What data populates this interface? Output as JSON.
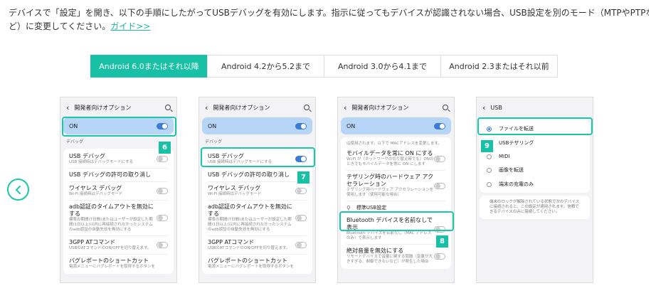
{
  "intro": {
    "text": "デバイスで「設定」を開き、以下の手順にしたがってUSBデバッグを有効にします。指示に従ってもデバイスが認識されない場合、USB設定を別のモード（MTPやPTPな",
    "text2": "ど）に変更してください。",
    "guide_link": "ガイド>>"
  },
  "tabs": [
    {
      "label": "Android 6.0またはそれ以降",
      "active": true
    },
    {
      "label": "Android 4.2から5.2まで",
      "active": false
    },
    {
      "label": "Android 3.0から4.1まで",
      "active": false
    },
    {
      "label": "Android 2.3またはそれ以前",
      "active": false
    }
  ],
  "screens": {
    "s1": {
      "title": "開発者向けオプション",
      "on": "ON",
      "section": "デバッグ",
      "rows": [
        {
          "t": "USB デバッグ",
          "s": "USB 接続時はデバッグモードにする"
        },
        {
          "t": "USB デバッグの許可の取り消し",
          "s": ""
        },
        {
          "t": "ワイヤレス デバッグ",
          "s": "Wi-Fi 接続時はデバッグモード"
        },
        {
          "t": "adb認証のタイムアウトを無効にする",
          "s": "標準の期間(7日間)またはユーザーが設定した期間(1日以上)以内に再接続されなかったシステムのadb認証の自動失効を無効にする"
        },
        {
          "t": "3GPP ATコマンド",
          "s": "USBのATコマンドのON/OFFを切り替えます。"
        },
        {
          "t": "バグレポートのショートカット",
          "s": "電源メニューにバグレポートを取得するボタンを"
        }
      ],
      "badge": "6"
    },
    "s2": {
      "title": "開発者向けオプション",
      "on": "ON",
      "section": "デバッグ",
      "rows": [
        {
          "t": "USB デバッグ",
          "s": "USB 接続時はデバッグモードにする"
        },
        {
          "t": "USB デバッグの許可の取り消し",
          "s": ""
        },
        {
          "t": "ワイヤレス デバッグ",
          "s": "Wi-Fi 接続時はデバッグモード"
        },
        {
          "t": "adb認証のタイムアウトを無効にする",
          "s": "標準の期間(7日間)またはユーザーが設定した期間(1日以上)以内に再接続されなかったシステムのadb認証の自動失効を無効にする"
        },
        {
          "t": "3GPP ATコマンド",
          "s": "USBのATコマンドのON/OFFを切り替えます。"
        },
        {
          "t": "バグレポートのショートカット",
          "s": "電源メニューにバグレポートを取得するボタンを"
        }
      ],
      "badge": "7"
    },
    "s3": {
      "title": "開発者向けオプション",
      "on": "ON",
      "top_note": "は使用されます。以下で MACアドレスを変更します。",
      "rows": [
        {
          "t": "モバイルデータを常に ON にする",
          "s": "Wi-Fi が（ネットワークの切り替え時でも）ONのときでもモバイルデータを常に ON にします"
        },
        {
          "t": "テザリング時のハードウェア アクセラレーション",
          "s": "テザリング用ハードウェア アクセラレーションを使用します（使用可能な場合）"
        },
        {
          "t": "Bluetooth デバイスを名前なしで表示",
          "s": "Bluetooth デバイスを名前なし（MAC アドレスのみ）で表示します"
        },
        {
          "t": "絶対音量を無効にする",
          "s": "リモートデバイスで音量に関する問題（音量が大きすぎる、制御できないなど）が発生した場合"
        }
      ],
      "usb_config": "標準USB設定",
      "badge": "8"
    },
    "s4": {
      "title": "USB",
      "options": [
        {
          "label": "ファイルを転送",
          "selected": true
        },
        {
          "label": "USBテザリング",
          "selected": false
        },
        {
          "label": "MIDI",
          "selected": false
        },
        {
          "label": "画像を転送",
          "selected": false
        },
        {
          "label": "端末の充電のみ",
          "selected": false
        }
      ],
      "note": "端末のロックが解除されている状態で次のデバイスに接続されると、この設定が適用されます。信頼できるデバイスのみに接続してください。",
      "badge": "9"
    }
  },
  "colors": {
    "accent": "#18c0a5",
    "toggle_on": "#3d7bd6",
    "on_bar": "#b7d6f7"
  }
}
